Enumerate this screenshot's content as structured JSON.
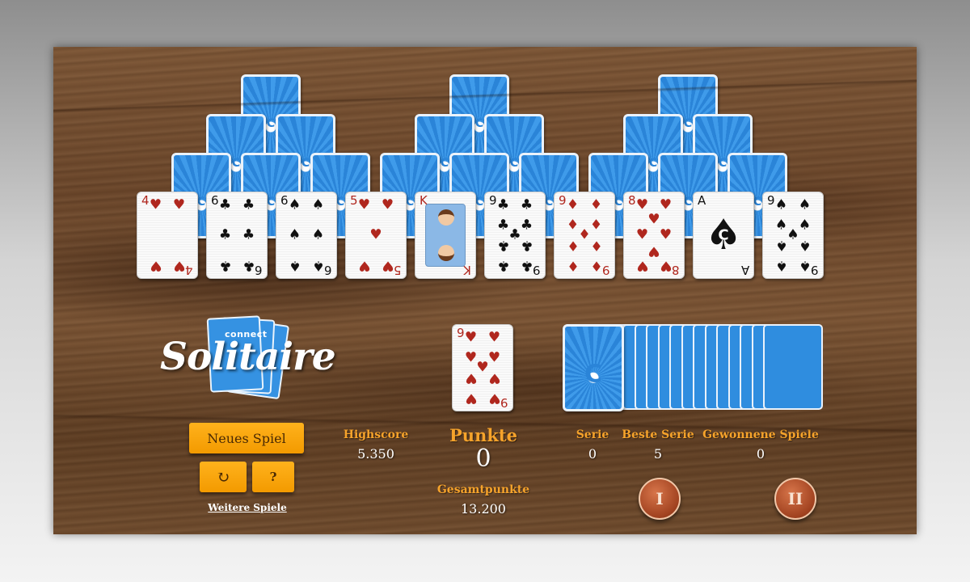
{
  "tableau": [
    {
      "rank": "4",
      "suit": "♥",
      "color": "red",
      "pips": 4
    },
    {
      "rank": "6",
      "suit": "♣",
      "color": "black",
      "pips": 6
    },
    {
      "rank": "6",
      "suit": "♠",
      "color": "black",
      "pips": 6
    },
    {
      "rank": "5",
      "suit": "♥",
      "color": "red",
      "pips": 5
    },
    {
      "rank": "K",
      "suit": "♦",
      "color": "red",
      "court": true
    },
    {
      "rank": "9",
      "suit": "♣",
      "color": "black",
      "pips": 9
    },
    {
      "rank": "9",
      "suit": "♦",
      "color": "red",
      "pips": 9
    },
    {
      "rank": "8",
      "suit": "♥",
      "color": "red",
      "pips": 8
    },
    {
      "rank": "A",
      "suit": "♠",
      "color": "black",
      "ace": true,
      "ace_mark": "C"
    },
    {
      "rank": "9",
      "suit": "♠",
      "color": "black",
      "pips": 9
    }
  ],
  "waste_card": {
    "rank": "9",
    "suit": "♥",
    "color": "red",
    "pips": 9
  },
  "card_back_mark": "C",
  "logo": {
    "small": "connect",
    "big": "Solitaire"
  },
  "buttons": {
    "new_game": "Neues Spiel",
    "restart_icon": "↻",
    "help": "?",
    "more_games": "Weitere Spiele"
  },
  "stats": {
    "highscore_label": "Highscore",
    "highscore_value": "5.350",
    "points_label": "Punkte",
    "points_value": "0",
    "total_label": "Gesamtpunkte",
    "total_value": "13.200",
    "streak_label": "Serie",
    "streak_value": "0",
    "best_streak_label": "Beste Serie",
    "best_streak_value": "5",
    "won_label": "Gewonnene Spiele",
    "won_value": "0"
  },
  "round_buttons": [
    "I",
    "II"
  ],
  "icons": {
    "restart": "refresh-icon"
  },
  "colors": {
    "accent": "#f39a00",
    "label": "#f6a32b",
    "card_back": "#2a84d8",
    "red_suit": "#b0271e"
  }
}
